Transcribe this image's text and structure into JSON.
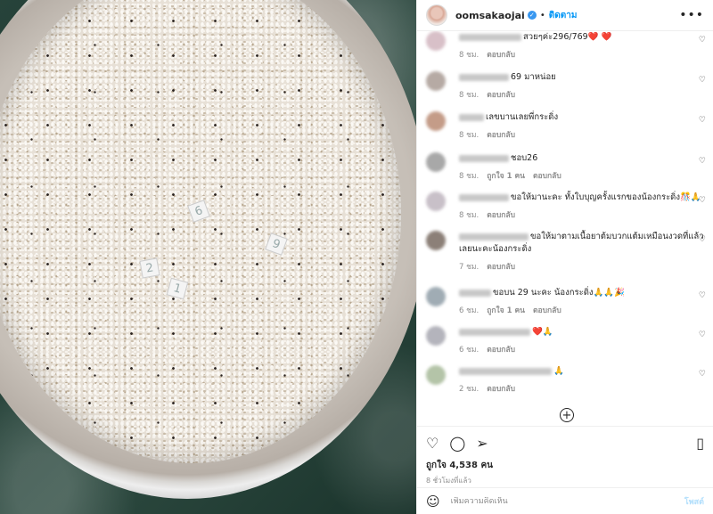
{
  "post": {
    "username": "oomsakaojai",
    "follow_label": "ติดตาม",
    "more_label": "•••",
    "photo_tags": [
      "6",
      "9",
      "2",
      "1"
    ]
  },
  "comments": [
    {
      "text": "สวยๆค่ะ296/769❤️ ❤️",
      "time": "8 ชม.",
      "likes": "",
      "reply": "ตอบกลับ",
      "avatar_color": "#d8c0c8",
      "name_width": 70
    },
    {
      "text": "69 มาหน่อย",
      "time": "8 ชม.",
      "likes": "",
      "reply": "ตอบกลับ",
      "avatar_color": "#b6aaa4",
      "name_width": 56
    },
    {
      "text": "เลขบานเลยพี่กระดิ่ง",
      "time": "8 ชม.",
      "likes": "",
      "reply": "ตอบกลับ",
      "avatar_color": "#c49c88",
      "name_width": 28
    },
    {
      "text": "ชอบ26",
      "time": "8 ชม.",
      "likes": "ถูกใจ 1 คน",
      "reply": "ตอบกลับ",
      "avatar_color": "#a8a8a8",
      "name_width": 56
    },
    {
      "text": "ขอให้มานะคะ ทั้งใบบุญครั้งแรกของน้องกระดิ่ง🎊🙏",
      "time": "8 ชม.",
      "likes": "",
      "reply": "ตอบกลับ",
      "avatar_color": "#c8c0c8",
      "name_width": 56
    },
    {
      "text": "ขอให้มาตามเนื้อยาต้มบวกแต้มเหมือนงวดที่แล้วเลยนะคะน้องกระดิ่ง",
      "time": "7 ชม.",
      "likes": "",
      "reply": "ตอบกลับ",
      "avatar_color": "#8c8078",
      "name_width": 78
    },
    {
      "text": "ขอบน 29 นะคะ น้องกระดิ่ง🙏🙏🎉",
      "time": "6 ชม.",
      "likes": "ถูกใจ 1 คน",
      "reply": "ตอบกลับ",
      "avatar_color": "#a0acb4",
      "name_width": 36
    },
    {
      "text": "❤️🙏",
      "time": "6 ชม.",
      "likes": "",
      "reply": "ตอบกลับ",
      "avatar_color": "#b4b4bc",
      "name_width": 80
    },
    {
      "text": "🙏",
      "time": "2 ชม.",
      "likes": "",
      "reply": "ตอบกลับ",
      "avatar_color": "#b4c4a8",
      "name_width": 104
    }
  ],
  "stats": {
    "likes_label": "ถูกใจ 4,538 คน",
    "time_label": "8 ชั่วโมงที่แล้ว"
  },
  "comment_input": {
    "placeholder": "เพิ่มความคิดเห็น",
    "post_label": "โพสต์"
  },
  "icons": {
    "heart": "heart-icon",
    "comment": "comment-icon",
    "share": "share-icon",
    "save": "bookmark-icon",
    "emoji": "emoji-icon",
    "add": "plus-circle-icon"
  }
}
